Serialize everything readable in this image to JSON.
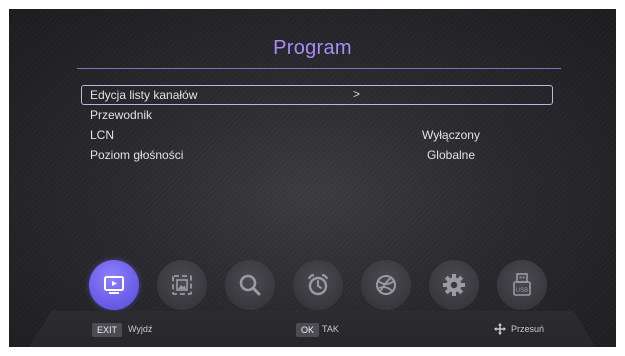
{
  "header": {
    "title": "Program"
  },
  "menu": {
    "items": [
      {
        "label": "Edycja listy kanałów",
        "value": "",
        "arrow": ">"
      },
      {
        "label": "Przewodnik",
        "value": ""
      },
      {
        "label": "LCN",
        "value": "Wyłączony"
      },
      {
        "label": "Poziom głośności",
        "value": "Globalne"
      }
    ]
  },
  "icons": [
    {
      "name": "tv-program-icon",
      "active": true
    },
    {
      "name": "picture-icon",
      "active": false
    },
    {
      "name": "search-icon",
      "active": false
    },
    {
      "name": "alarm-clock-icon",
      "active": false
    },
    {
      "name": "globe-icon",
      "active": false
    },
    {
      "name": "gear-icon",
      "active": false
    },
    {
      "name": "usb-icon",
      "active": false
    }
  ],
  "icon_text": {
    "usb": "USB"
  },
  "footer": {
    "exit_key": "EXIT",
    "exit_label": "Wyjdź",
    "ok_key": "OK",
    "ok_label": "TAK",
    "move_label": "Przesuń"
  },
  "colors": {
    "accent": "#6b5ee8",
    "title": "#a98cf5",
    "selection_border": "#b9b4ea"
  }
}
